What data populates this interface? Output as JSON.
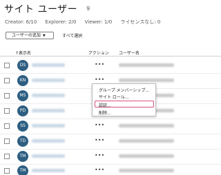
{
  "page": {
    "title": "サイト ユーザー",
    "count": "9"
  },
  "stats": [
    "Creator: 6/10",
    "Explorer: 2/0",
    "Viewer: 1/0",
    "ライセンスなし: 0"
  ],
  "toolbar": {
    "add_user_label": "ユーザーの追加",
    "select_all_label": "すべて選択"
  },
  "table": {
    "columns": {
      "display_name": "↑表示名",
      "actions": "アクション",
      "username": "ユーザー名"
    },
    "rows": [
      {
        "initials": "DS",
        "actions": "•••"
      },
      {
        "initials": "KN",
        "actions": "•••"
      },
      {
        "initials": "MS",
        "actions": "•••"
      },
      {
        "initials": "PD",
        "actions": "•••"
      },
      {
        "initials": "SS",
        "actions": "•••"
      },
      {
        "initials": "TD",
        "actions": "•••"
      },
      {
        "initials": "TM",
        "actions": "•••"
      },
      {
        "initials": "TM",
        "actions": "•••"
      }
    ]
  },
  "context_menu": {
    "items": [
      "グループ メンバーシップ...",
      "サイト ロール...",
      "認証...",
      "削除..."
    ],
    "highlighted_index": 2
  },
  "colors": {
    "avatar": "#2e5f82",
    "highlight": "#d6507c"
  }
}
